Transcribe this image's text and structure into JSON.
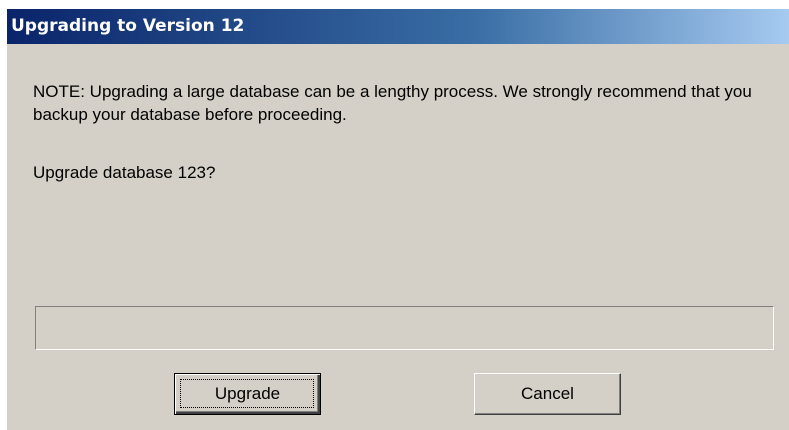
{
  "window": {
    "title": "Upgrading to Version 12"
  },
  "message": {
    "note": "NOTE: Upgrading a large database can be a lengthy process. We strongly recommend that you backup your database before proceeding.",
    "question": "Upgrade database 123?"
  },
  "progress": {
    "fraction": 0
  },
  "buttons": {
    "upgrade_label": "Upgrade",
    "cancel_label": "Cancel"
  },
  "colors": {
    "title_bar_start": "#0a246a",
    "title_bar_end": "#a6caf0",
    "dialog_face": "#d4d0c8"
  }
}
